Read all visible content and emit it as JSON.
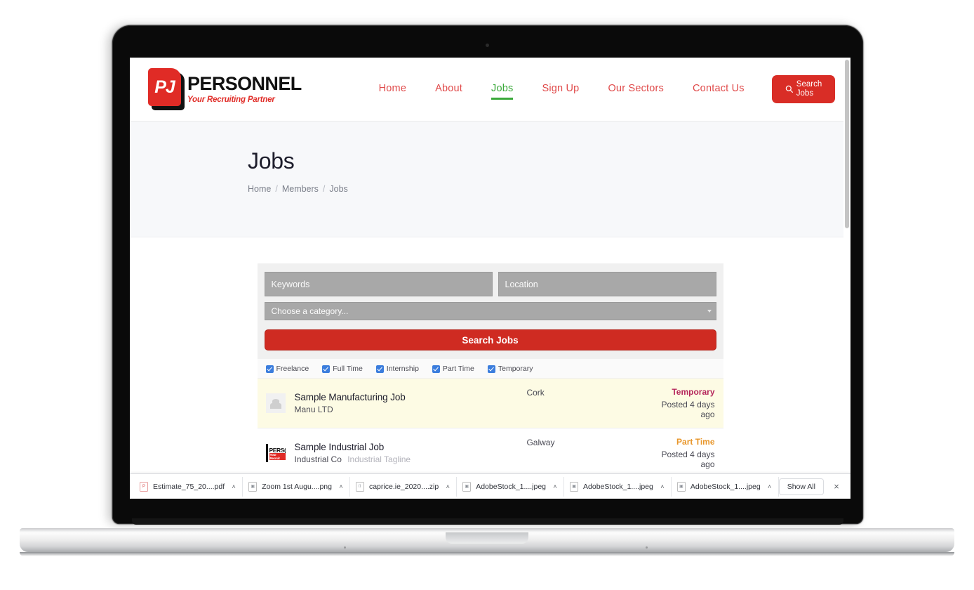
{
  "brand": {
    "badge_text": "PJ",
    "name": "PERSONNEL",
    "tagline": "Your Recruiting Partner"
  },
  "header": {
    "nav": [
      {
        "label": "Home",
        "active": false
      },
      {
        "label": "About",
        "active": false
      },
      {
        "label": "Jobs",
        "active": true
      },
      {
        "label": "Sign Up",
        "active": false
      },
      {
        "label": "Our Sectors",
        "active": false
      },
      {
        "label": "Contact Us",
        "active": false
      }
    ],
    "search_button": {
      "line1": "Search",
      "line2": "Jobs",
      "icon": "search-icon"
    },
    "accent_red": "#d92d26",
    "accent_green": "#3aa93a"
  },
  "hero": {
    "title": "Jobs",
    "breadcrumb": [
      {
        "label": "Home"
      },
      {
        "label": "Members"
      },
      {
        "label": "Jobs"
      }
    ],
    "separator": "/"
  },
  "search_form": {
    "keywords_placeholder": "Keywords",
    "location_placeholder": "Location",
    "category_placeholder": "Choose a category...",
    "submit_label": "Search Jobs"
  },
  "filters": [
    {
      "label": "Freelance",
      "checked": true
    },
    {
      "label": "Full Time",
      "checked": true
    },
    {
      "label": "Internship",
      "checked": true
    },
    {
      "label": "Part Time",
      "checked": true
    },
    {
      "label": "Temporary",
      "checked": true
    }
  ],
  "jobs": [
    {
      "title": "Sample Manufacturing Job",
      "company": "Manu LTD",
      "tagline": "",
      "location": "Cork",
      "type": "Temporary",
      "type_color": "#b5275c",
      "date": "Posted 4 days ago",
      "featured": true,
      "logo": "placeholder-image-icon"
    },
    {
      "title": "Sample Industrial Job",
      "company": "Industrial Co",
      "tagline": "Industrial Tagline",
      "location": "Galway",
      "type": "Part Time",
      "type_color": "#e8962a",
      "date": "Posted 4 days ago",
      "featured": false,
      "logo": "pj-personnel-logo"
    }
  ],
  "downloads": {
    "items": [
      {
        "name": "Estimate_75_20....pdf",
        "kind": "pdf"
      },
      {
        "name": "Zoom 1st Augu....png",
        "kind": "img"
      },
      {
        "name": "caprice.ie_2020....zip",
        "kind": "zip"
      },
      {
        "name": "AdobeStock_1....jpeg",
        "kind": "img"
      },
      {
        "name": "AdobeStock_1....jpeg",
        "kind": "img"
      },
      {
        "name": "AdobeStock_1....jpeg",
        "kind": "img"
      }
    ],
    "show_all_label": "Show All",
    "close_label": "×",
    "caret": "˄"
  }
}
